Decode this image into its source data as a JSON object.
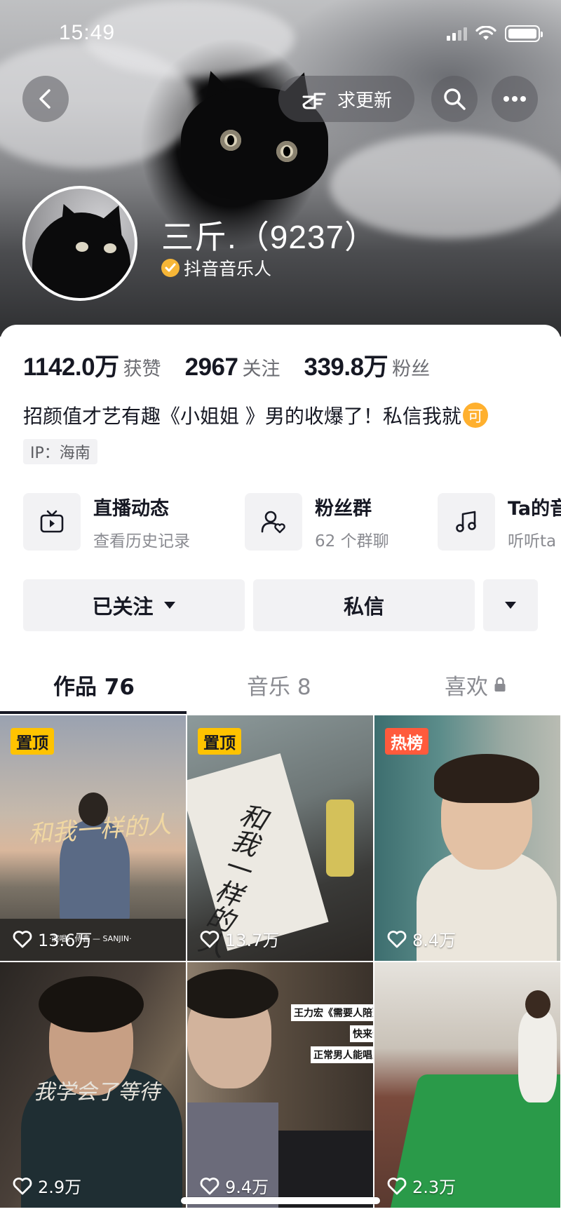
{
  "status_bar": {
    "time": "15:49"
  },
  "top_actions": {
    "request_update_label": "求更新"
  },
  "profile": {
    "nickname": "三斤.（9237）",
    "certification": "抖音音乐人",
    "stats": [
      {
        "value": "1142.0万",
        "label": "获赞"
      },
      {
        "value": "2967",
        "label": "关注"
      },
      {
        "value": "339.8万",
        "label": "粉丝"
      }
    ],
    "bio": "招颜值才艺有趣《小姐姐 》男的收爆了！私信我就",
    "bio_badge": "可",
    "ip": "IP：海南"
  },
  "features": [
    {
      "title": "直播动态",
      "subtitle": "查看历史记录",
      "icon": "tv-icon"
    },
    {
      "title": "粉丝群",
      "subtitle": "62 个群聊",
      "icon": "fan-group-icon"
    },
    {
      "title": "Ta的音",
      "subtitle": "听听ta",
      "icon": "music-note-icon"
    }
  ],
  "actions": {
    "followed_label": "已关注",
    "message_label": "私信"
  },
  "tabs": [
    {
      "label": "作品 76"
    },
    {
      "label": "音乐 8"
    },
    {
      "label": "喜欢"
    }
  ],
  "videos": [
    {
      "badge": "置顶",
      "badge_type": "pin",
      "caption": "和我一样的人",
      "credit": "·演唱：侍鑫 — SANJIN·",
      "likes": "13.6万"
    },
    {
      "badge": "置顶",
      "badge_type": "pin",
      "caption": "和我一样的人",
      "likes": "13.7万"
    },
    {
      "badge": "热榜",
      "badge_type": "hot",
      "likes": "8.4万"
    },
    {
      "caption": "我学会了等待",
      "likes": "2.9万"
    },
    {
      "overlay_lines": [
        "王力宏《需要人陪》！",
        "快来合拍",
        "正常男人能唱上去"
      ],
      "likes": "9.4万"
    },
    {
      "likes": "2.3万"
    }
  ]
}
